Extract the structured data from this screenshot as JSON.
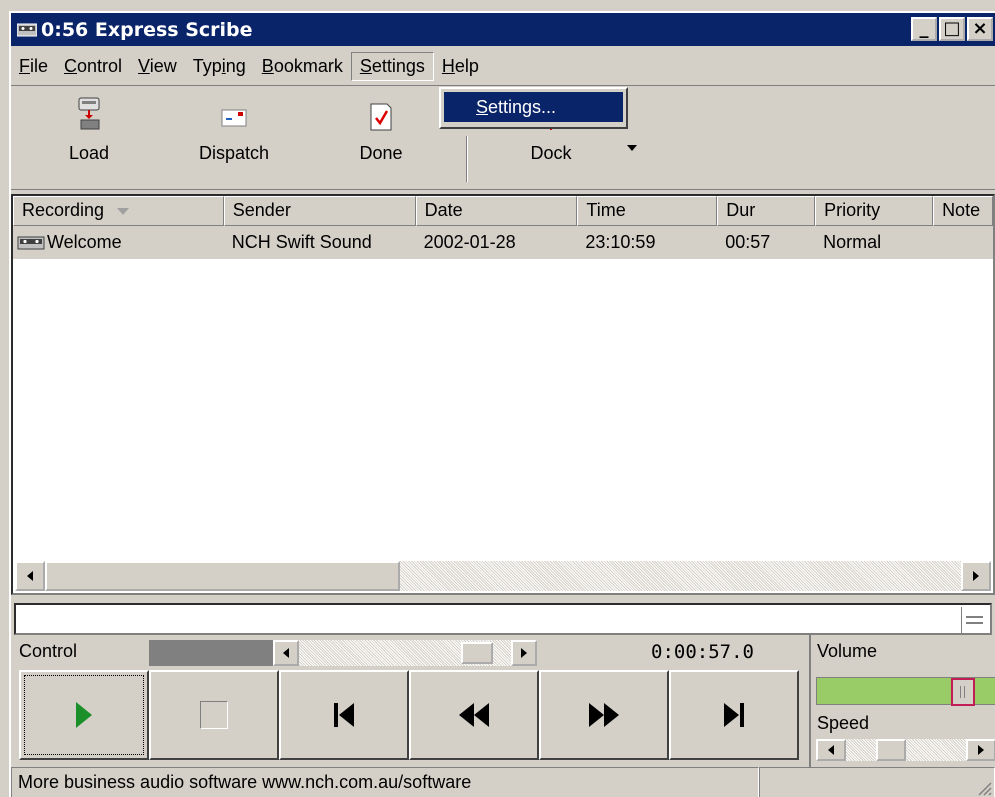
{
  "window": {
    "title": "0:56 Express Scribe"
  },
  "titlebar_buttons": {
    "minimize": "_",
    "maximize": "□",
    "close": "×"
  },
  "menu": [
    {
      "pre": "",
      "key": "F",
      "post": "ile"
    },
    {
      "pre": "",
      "key": "C",
      "post": "ontrol"
    },
    {
      "pre": "",
      "key": "V",
      "post": "iew"
    },
    {
      "pre": "Typ",
      "key": "i",
      "post": "ng"
    },
    {
      "pre": "",
      "key": "B",
      "post": "ookmark"
    },
    {
      "pre": "",
      "key": "S",
      "post": "ettings"
    },
    {
      "pre": "",
      "key": "H",
      "post": "elp"
    }
  ],
  "dropdown": {
    "item_key": "S",
    "item_rest": "ettings..."
  },
  "toolbar": {
    "load": "Load",
    "dispatch": "Dispatch",
    "done": "Done",
    "dock": "Dock"
  },
  "list": {
    "headers": [
      "Recording",
      "Sender",
      "Date",
      "Time",
      "Dur",
      "Priority",
      "Note"
    ],
    "rows": [
      {
        "recording": "Welcome",
        "sender": "NCH Swift Sound",
        "date": "2002-01-28",
        "time": "23:10:59",
        "dur": "00:57",
        "priority": "Normal",
        "note": ""
      }
    ]
  },
  "playback": {
    "control_label": "Control",
    "time": "0:00:57.0",
    "position_fraction": 0.32
  },
  "volume": {
    "label": "Volume",
    "level": 0.86
  },
  "speed": {
    "label": "Speed",
    "level": 0.3
  },
  "status": {
    "text": "More business audio software www.nch.com.au/software"
  },
  "colors": {
    "titlebar": "#0a246a",
    "face": "#d4d0c8",
    "volume_fill": "#99cc66",
    "play_green": "#1a8f2a",
    "volume_thumb_border": "#c21e56"
  }
}
